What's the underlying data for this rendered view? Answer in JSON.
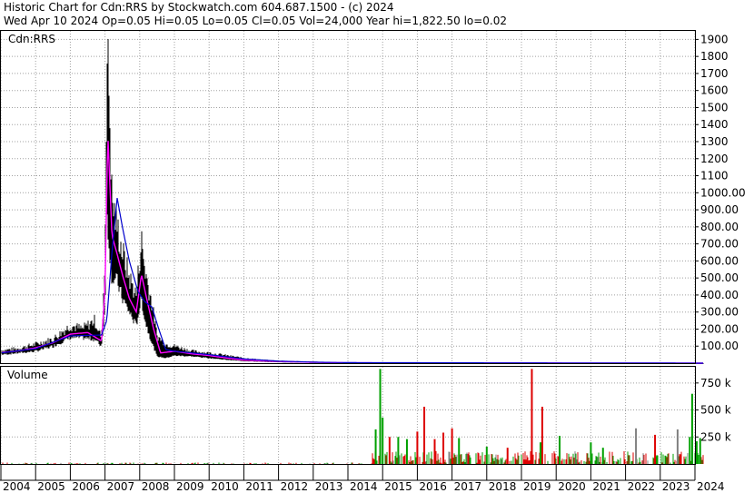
{
  "header": {
    "line1": "Historic Chart for Cdn:RRS by Stockwatch.com 604.687.1500 - (c) 2024",
    "line2": "Wed Apr 10 2024  Op=0.05  Hi=0.05  Lo=0.05  Cl=0.05  Vol=24,000  Year hi=1,822.50  lo=0.02"
  },
  "colors": {
    "background": "#ffffff",
    "grid": "#a0a0a0",
    "price_bar": "#000000",
    "ma_short": "#ff00ff",
    "ma_short_alt": "#cc0000",
    "ma_long": "#0000cc",
    "volume_up": "#00a000",
    "volume_down": "#dd0000",
    "volume_neutral": "#808080"
  },
  "chart_data": [
    {
      "type": "line",
      "title": "",
      "legend": "Cdn:RRS",
      "x_start": "2004",
      "x_end": "2024",
      "ylim": [
        0,
        1950
      ],
      "yticks": [
        {
          "v": 100,
          "label": "100.00"
        },
        {
          "v": 200,
          "label": "200.00"
        },
        {
          "v": 300,
          "label": "300.00"
        },
        {
          "v": 400,
          "label": "400.00"
        },
        {
          "v": 500,
          "label": "500.00"
        },
        {
          "v": 600,
          "label": "600.00"
        },
        {
          "v": 700,
          "label": "700.00"
        },
        {
          "v": 800,
          "label": "800.00"
        },
        {
          "v": 900,
          "label": "900.00"
        },
        {
          "v": 1000,
          "label": "1000.00"
        },
        {
          "v": 1100,
          "label": "1100"
        },
        {
          "v": 1200,
          "label": "1200"
        },
        {
          "v": 1300,
          "label": "1300"
        },
        {
          "v": 1400,
          "label": "1400"
        },
        {
          "v": 1500,
          "label": "1500"
        },
        {
          "v": 1600,
          "label": "1600"
        },
        {
          "v": 1700,
          "label": "1700"
        },
        {
          "v": 1800,
          "label": "1800"
        },
        {
          "v": 1900,
          "label": "1900"
        }
      ],
      "series": [
        {
          "role": "price_high_low",
          "points": [
            {
              "x": 2004.0,
              "hi": 75,
              "lo": 50
            },
            {
              "x": 2004.5,
              "hi": 85,
              "lo": 60
            },
            {
              "x": 2005.0,
              "hi": 110,
              "lo": 70
            },
            {
              "x": 2005.5,
              "hi": 140,
              "lo": 100
            },
            {
              "x": 2006.0,
              "hi": 220,
              "lo": 150
            },
            {
              "x": 2006.35,
              "hi": 200,
              "lo": 150
            },
            {
              "x": 2006.7,
              "hi": 250,
              "lo": 140
            },
            {
              "x": 2006.9,
              "hi": 150,
              "lo": 100
            },
            {
              "x": 2007.0,
              "hi": 600,
              "lo": 320
            },
            {
              "x": 2007.05,
              "hi": 1822,
              "lo": 900
            },
            {
              "x": 2007.12,
              "hi": 1600,
              "lo": 700
            },
            {
              "x": 2007.2,
              "hi": 950,
              "lo": 500
            },
            {
              "x": 2007.35,
              "hi": 800,
              "lo": 480
            },
            {
              "x": 2007.5,
              "hi": 650,
              "lo": 380
            },
            {
              "x": 2007.7,
              "hi": 500,
              "lo": 300
            },
            {
              "x": 2007.9,
              "hi": 400,
              "lo": 220
            },
            {
              "x": 2008.05,
              "hi": 720,
              "lo": 380
            },
            {
              "x": 2008.15,
              "hi": 550,
              "lo": 250
            },
            {
              "x": 2008.35,
              "hi": 350,
              "lo": 120
            },
            {
              "x": 2008.5,
              "hi": 160,
              "lo": 40
            },
            {
              "x": 2008.75,
              "hi": 110,
              "lo": 30
            },
            {
              "x": 2009.0,
              "hi": 100,
              "lo": 45
            },
            {
              "x": 2009.5,
              "hi": 70,
              "lo": 40
            },
            {
              "x": 2010.0,
              "hi": 60,
              "lo": 30
            },
            {
              "x": 2010.5,
              "hi": 45,
              "lo": 20
            },
            {
              "x": 2011.0,
              "hi": 30,
              "lo": 12
            },
            {
              "x": 2011.5,
              "hi": 20,
              "lo": 8
            },
            {
              "x": 2012.0,
              "hi": 14,
              "lo": 5
            },
            {
              "x": 2013.0,
              "hi": 8,
              "lo": 2
            },
            {
              "x": 2014.0,
              "hi": 4,
              "lo": 1
            },
            {
              "x": 2016.0,
              "hi": 2,
              "lo": 0.5
            },
            {
              "x": 2020.0,
              "hi": 1,
              "lo": 0.1
            },
            {
              "x": 2024.0,
              "hi": 0.5,
              "lo": 0.02
            }
          ]
        },
        {
          "role": "moving_average_short",
          "points": [
            {
              "x": 2004.0,
              "y": 62
            },
            {
              "x": 2004.5,
              "y": 72
            },
            {
              "x": 2005.0,
              "y": 90
            },
            {
              "x": 2005.5,
              "y": 120
            },
            {
              "x": 2006.0,
              "y": 170
            },
            {
              "x": 2006.5,
              "y": 180
            },
            {
              "x": 2006.9,
              "y": 130
            },
            {
              "x": 2007.0,
              "y": 430
            },
            {
              "x": 2007.08,
              "y": 1350
            },
            {
              "x": 2007.2,
              "y": 750
            },
            {
              "x": 2007.35,
              "y": 640
            },
            {
              "x": 2007.5,
              "y": 520
            },
            {
              "x": 2007.7,
              "y": 380
            },
            {
              "x": 2007.9,
              "y": 300
            },
            {
              "x": 2008.05,
              "y": 520
            },
            {
              "x": 2008.2,
              "y": 380
            },
            {
              "x": 2008.4,
              "y": 200
            },
            {
              "x": 2008.6,
              "y": 60
            },
            {
              "x": 2009.0,
              "y": 70
            },
            {
              "x": 2009.5,
              "y": 55
            },
            {
              "x": 2010.0,
              "y": 45
            },
            {
              "x": 2010.5,
              "y": 30
            },
            {
              "x": 2011.0,
              "y": 18
            },
            {
              "x": 2012.0,
              "y": 10
            },
            {
              "x": 2013.0,
              "y": 5
            },
            {
              "x": 2014.0,
              "y": 2
            },
            {
              "x": 2024.0,
              "y": 0.05
            }
          ]
        },
        {
          "role": "moving_average_long",
          "points": [
            {
              "x": 2004.0,
              "y": 60
            },
            {
              "x": 2005.0,
              "y": 85
            },
            {
              "x": 2006.0,
              "y": 160
            },
            {
              "x": 2006.9,
              "y": 165
            },
            {
              "x": 2007.05,
              "y": 250
            },
            {
              "x": 2007.2,
              "y": 650
            },
            {
              "x": 2007.35,
              "y": 970
            },
            {
              "x": 2007.5,
              "y": 800
            },
            {
              "x": 2007.7,
              "y": 600
            },
            {
              "x": 2007.95,
              "y": 420
            },
            {
              "x": 2008.15,
              "y": 360
            },
            {
              "x": 2008.35,
              "y": 330
            },
            {
              "x": 2008.55,
              "y": 200
            },
            {
              "x": 2008.75,
              "y": 80
            },
            {
              "x": 2009.0,
              "y": 70
            },
            {
              "x": 2010.0,
              "y": 50
            },
            {
              "x": 2011.0,
              "y": 25
            },
            {
              "x": 2012.0,
              "y": 12
            },
            {
              "x": 2013.0,
              "y": 6
            },
            {
              "x": 2014.0,
              "y": 3
            },
            {
              "x": 2024.0,
              "y": 0.1
            }
          ]
        }
      ]
    },
    {
      "type": "bar",
      "title": "Volume",
      "ylim": [
        0,
        900
      ],
      "yticks": [
        {
          "v": 250,
          "label": "250  k"
        },
        {
          "v": 500,
          "label": "500  k"
        },
        {
          "v": 750,
          "label": "750  k"
        }
      ],
      "spikes": [
        {
          "x": 2014.93,
          "v": 880,
          "c": "up"
        },
        {
          "x": 2014.8,
          "v": 320,
          "c": "up"
        },
        {
          "x": 2015.0,
          "v": 430,
          "c": "up"
        },
        {
          "x": 2015.2,
          "v": 250,
          "c": "down"
        },
        {
          "x": 2015.45,
          "v": 250,
          "c": "up"
        },
        {
          "x": 2015.7,
          "v": 230,
          "c": "up"
        },
        {
          "x": 2016.0,
          "v": 300,
          "c": "down"
        },
        {
          "x": 2016.2,
          "v": 530,
          "c": "down"
        },
        {
          "x": 2016.5,
          "v": 230,
          "c": "down"
        },
        {
          "x": 2016.75,
          "v": 290,
          "c": "down"
        },
        {
          "x": 2017.0,
          "v": 330,
          "c": "down"
        },
        {
          "x": 2017.2,
          "v": 240,
          "c": "up"
        },
        {
          "x": 2018.0,
          "v": 160,
          "c": "up"
        },
        {
          "x": 2018.6,
          "v": 150,
          "c": "down"
        },
        {
          "x": 2019.3,
          "v": 880,
          "c": "down"
        },
        {
          "x": 2019.6,
          "v": 530,
          "c": "down"
        },
        {
          "x": 2019.55,
          "v": 200,
          "c": "up"
        },
        {
          "x": 2020.1,
          "v": 260,
          "c": "up"
        },
        {
          "x": 2021.0,
          "v": 200,
          "c": "up"
        },
        {
          "x": 2021.35,
          "v": 150,
          "c": "up"
        },
        {
          "x": 2022.3,
          "v": 330,
          "c": "neutral"
        },
        {
          "x": 2022.85,
          "v": 270,
          "c": "down"
        },
        {
          "x": 2023.5,
          "v": 320,
          "c": "neutral"
        },
        {
          "x": 2023.85,
          "v": 250,
          "c": "up"
        },
        {
          "x": 2023.92,
          "v": 650,
          "c": "up"
        },
        {
          "x": 2024.05,
          "v": 210,
          "c": "up"
        },
        {
          "x": 2024.15,
          "v": 240,
          "c": "up"
        }
      ]
    }
  ],
  "x_axis": {
    "labels": [
      "2004",
      "2005",
      "2006",
      "2007",
      "2008",
      "2009",
      "2010",
      "2011",
      "2012",
      "2013",
      "2014",
      "2015",
      "2016",
      "2017",
      "2018",
      "2019",
      "2020",
      "2021",
      "2022",
      "2023",
      "2024"
    ]
  }
}
